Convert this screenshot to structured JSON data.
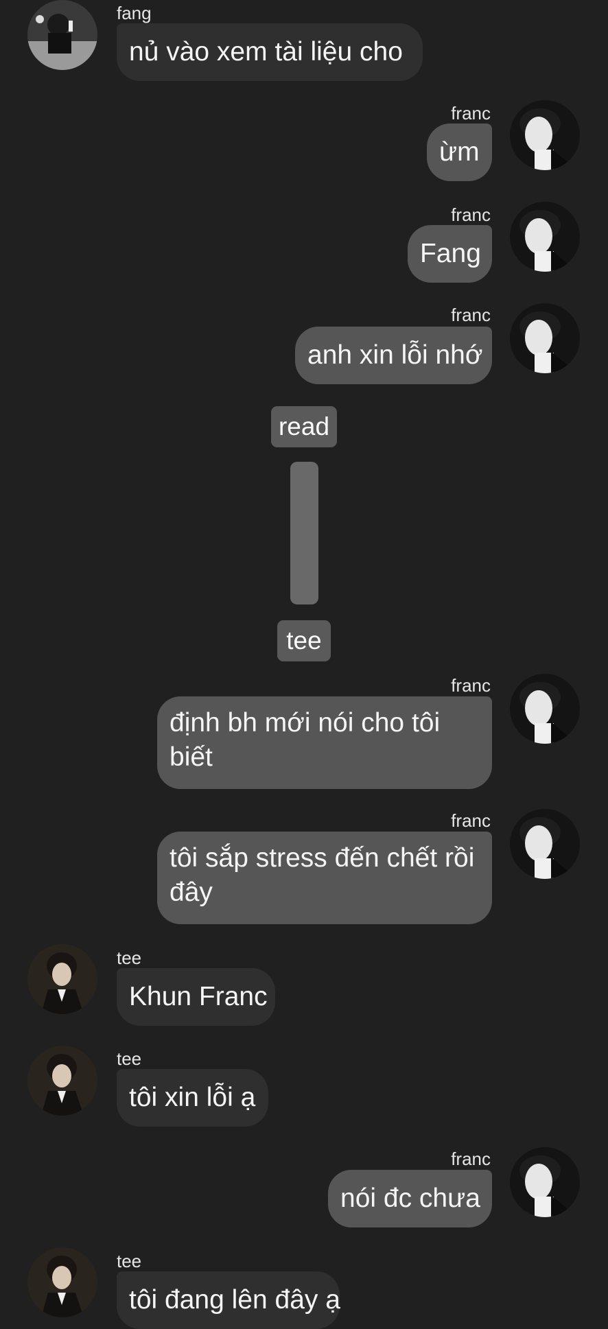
{
  "messages": [
    {
      "sender": "fang",
      "side": "in",
      "text": "nủ vào xem tài liệu cho"
    },
    {
      "sender": "franc",
      "side": "out",
      "text": "ừm"
    },
    {
      "sender": "franc",
      "side": "out",
      "text": "Fang"
    },
    {
      "sender": "franc",
      "side": "out",
      "text": "anh xin lỗi nhớ"
    },
    {
      "sender": "franc",
      "side": "out",
      "text": "định bh mới nói cho tôi biết"
    },
    {
      "sender": "franc",
      "side": "out",
      "text": "tôi sắp stress đến chết rồi đây"
    },
    {
      "sender": "tee",
      "side": "in",
      "text": "Khun Franc"
    },
    {
      "sender": "tee",
      "side": "in",
      "text": "tôi xin lỗi ạ"
    },
    {
      "sender": "franc",
      "side": "out",
      "text": "nói đc chưa"
    },
    {
      "sender": "tee",
      "side": "in",
      "text": "tôi đang lên đây ạ"
    }
  ],
  "separator": {
    "top_label": "read",
    "bottom_label": "tee"
  },
  "colors": {
    "background": "#202020",
    "incoming_bubble": "#2f2f2f",
    "outgoing_bubble": "#565656",
    "pill": "#5a5a5a"
  },
  "icons": {
    "fang_avatar": "avatar-photo",
    "franc_avatar": "avatar-photo",
    "tee_avatar": "avatar-photo"
  }
}
